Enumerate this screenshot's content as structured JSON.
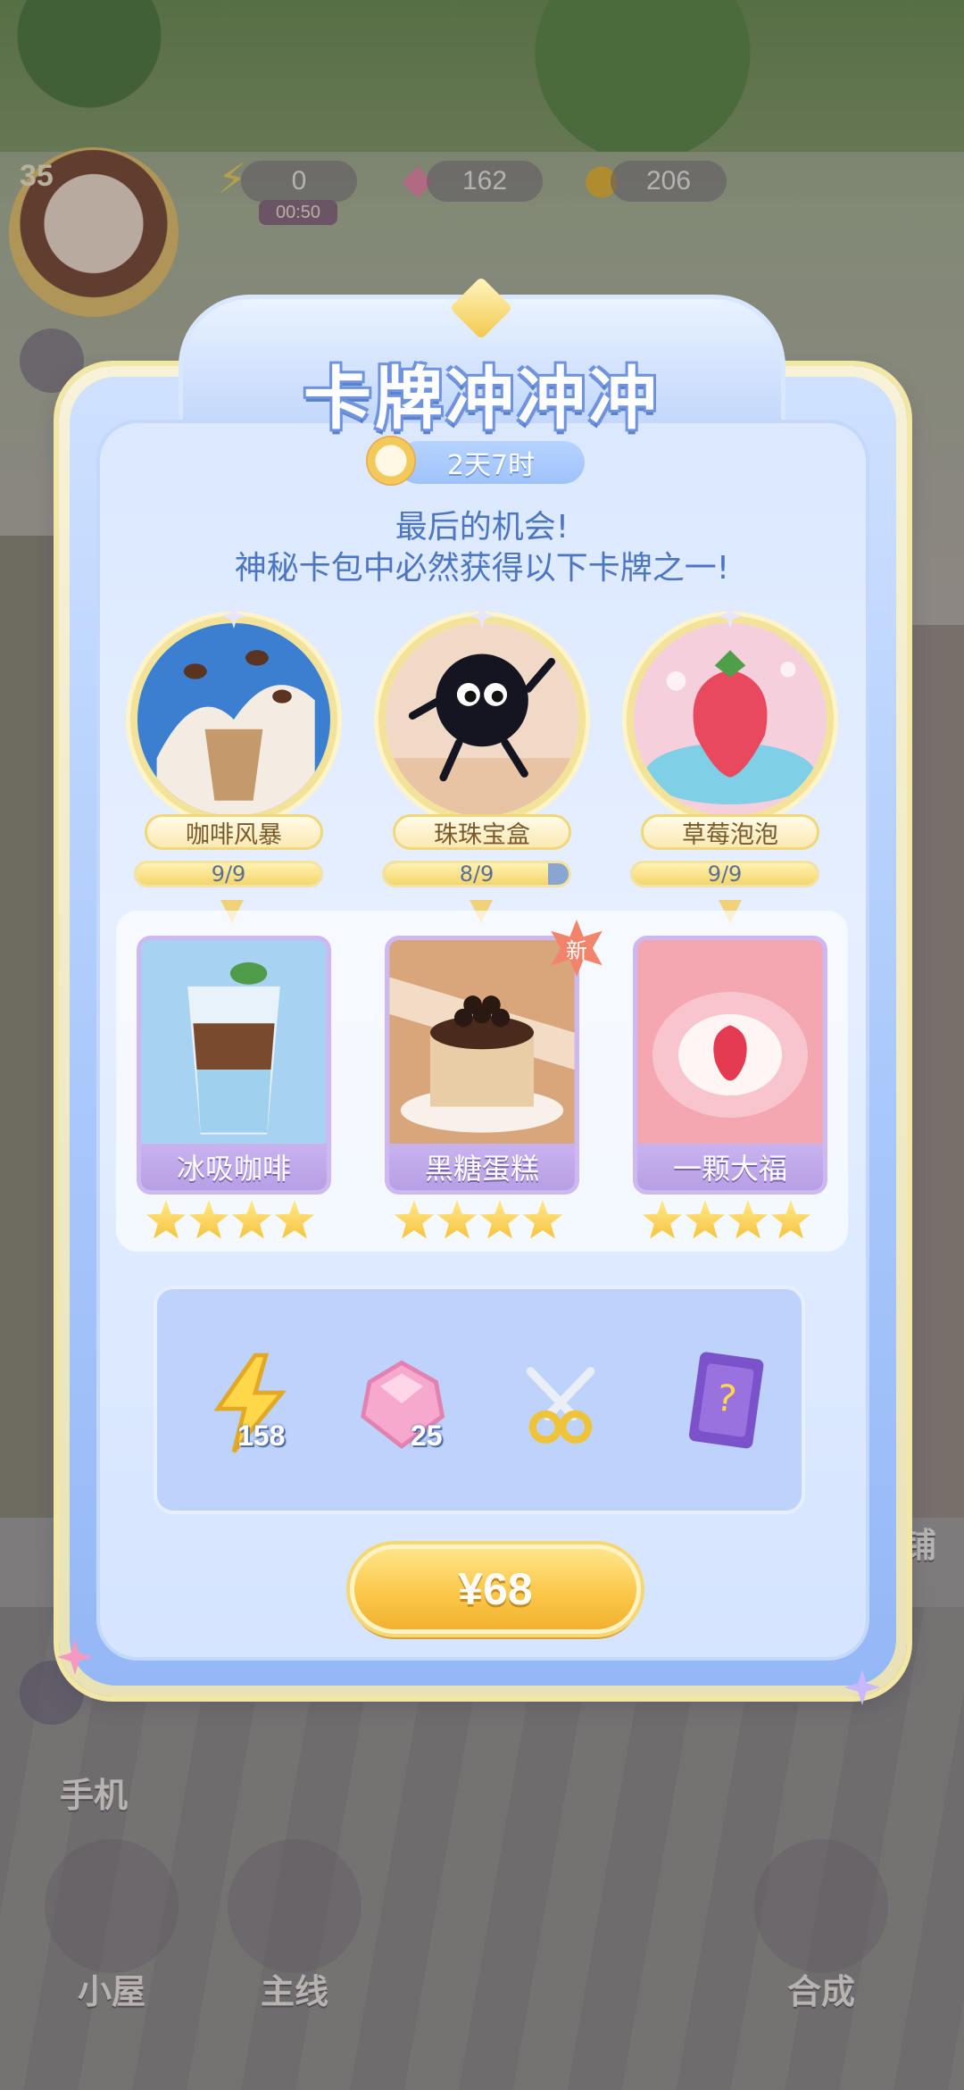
{
  "hud": {
    "player_level": "35",
    "energy_value": "0",
    "energy_timer": "00:50",
    "gems_value": "162",
    "coins_value": "206"
  },
  "bottom_nav": {
    "phone_label": "手机",
    "house_label": "小屋",
    "main_label": "主线",
    "merge_label": "合成",
    "shop_partial": "铺"
  },
  "popup": {
    "title": "卡牌冲冲冲",
    "timer": "2天7时",
    "subtitle_line1": "最后的机会!",
    "subtitle_line2": "神秘卡包中必然获得以下卡牌之一!"
  },
  "packs": [
    {
      "name": "咖啡风暴",
      "progress_text": "9/9",
      "progress": 1.0
    },
    {
      "name": "珠珠宝盒",
      "progress_text": "8/9",
      "progress": 0.889
    },
    {
      "name": "草莓泡泡",
      "progress_text": "9/9",
      "progress": 1.0
    }
  ],
  "cards": [
    {
      "name": "冰吸咖啡",
      "stars": 4,
      "is_new": false
    },
    {
      "name": "黑糖蛋糕",
      "stars": 4,
      "is_new": true
    },
    {
      "name": "一颗大福",
      "stars": 4,
      "is_new": false
    }
  ],
  "new_badge_label": "新",
  "rewards": [
    {
      "icon": "energy-bolt-icon",
      "count": "158"
    },
    {
      "icon": "pink-gem-icon",
      "count": "25"
    },
    {
      "icon": "scissors-icon",
      "count": ""
    },
    {
      "icon": "mystery-card-pack-icon",
      "count": ""
    }
  ],
  "buy_button": {
    "label": "¥68"
  },
  "colors": {
    "title_outline": "#6f93de",
    "panel_blue": "#bed3fb",
    "button_gold": "#fbc84a",
    "card_purple": "#cbb6ef"
  }
}
